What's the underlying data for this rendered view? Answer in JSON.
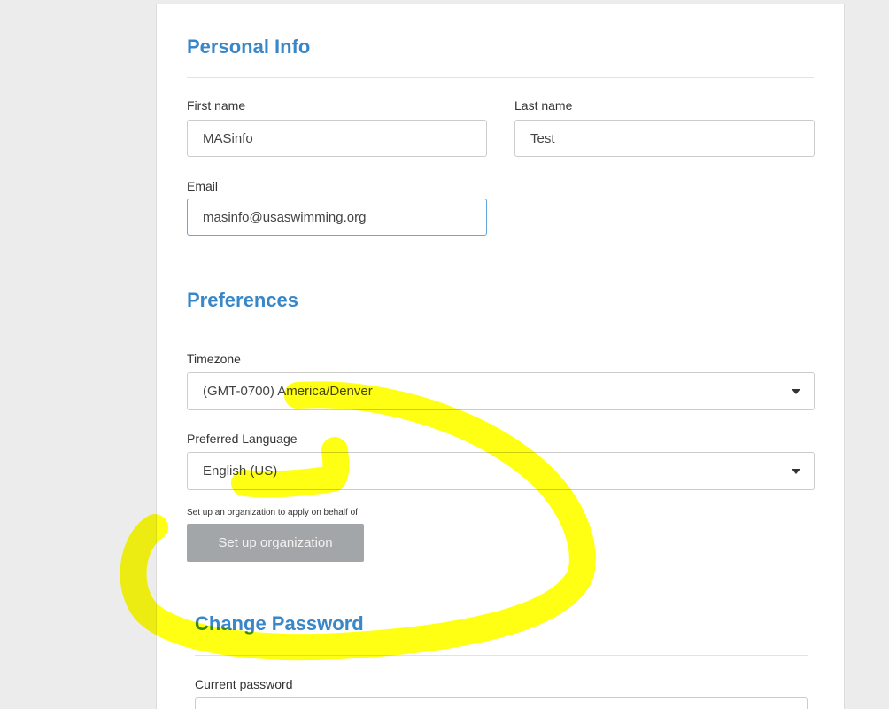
{
  "personal_info": {
    "title": "Personal Info",
    "first_name_label": "First name",
    "first_name_value": "MASinfo",
    "last_name_label": "Last name",
    "last_name_value": "Test",
    "email_label": "Email",
    "email_value": "masinfo@usaswimming.org"
  },
  "preferences": {
    "title": "Preferences",
    "timezone_label": "Timezone",
    "timezone_value": "(GMT-0700) America/Denver",
    "language_label": "Preferred Language",
    "language_value": "English (US)",
    "organization_note": "Set up an organization to apply on behalf of",
    "organization_button": "Set up organization"
  },
  "change_password": {
    "title": "Change Password",
    "current_password_label": "Current password"
  },
  "colors": {
    "heading": "#3a87c8",
    "button_bg": "#a3a6a9",
    "highlight": "#ffff00",
    "focus_border": "#66a7dc"
  },
  "icons": {
    "select_caret": "chevron-down-icon"
  }
}
